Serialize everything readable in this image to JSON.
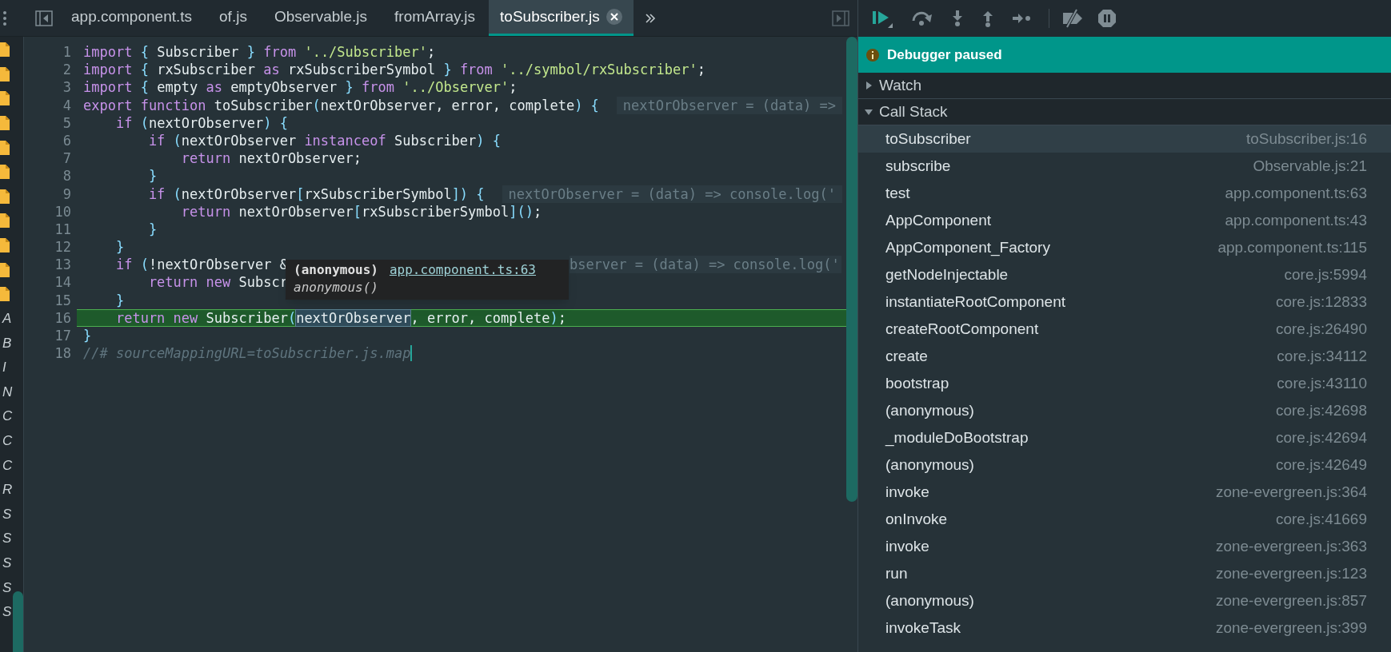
{
  "navigator": {
    "items": [
      {
        "kind": "file"
      },
      {
        "kind": "file"
      },
      {
        "kind": "file"
      },
      {
        "kind": "file"
      },
      {
        "kind": "file"
      },
      {
        "kind": "file"
      },
      {
        "kind": "file"
      },
      {
        "kind": "file"
      },
      {
        "kind": "file"
      },
      {
        "kind": "file"
      },
      {
        "kind": "file"
      },
      {
        "kind": "name",
        "text": "A"
      },
      {
        "kind": "name",
        "text": "B"
      },
      {
        "kind": "name",
        "text": "I"
      },
      {
        "kind": "name",
        "text": "N"
      },
      {
        "kind": "name",
        "text": "C"
      },
      {
        "kind": "name",
        "text": "C"
      },
      {
        "kind": "name",
        "text": "C"
      },
      {
        "kind": "name",
        "text": "R"
      },
      {
        "kind": "name",
        "text": "S"
      },
      {
        "kind": "name",
        "text": "S"
      },
      {
        "kind": "name",
        "text": "S"
      },
      {
        "kind": "name",
        "text": "S"
      },
      {
        "kind": "name",
        "text": "S"
      }
    ]
  },
  "tabs": [
    {
      "label": "app.component.ts",
      "selected": false
    },
    {
      "label": "of.js",
      "selected": false
    },
    {
      "label": "Observable.js",
      "selected": false
    },
    {
      "label": "fromArray.js",
      "selected": false
    },
    {
      "label": "toSubscriber.js",
      "selected": true
    }
  ],
  "editor": {
    "lines": [
      {
        "number": "1",
        "current": false,
        "tokens": [
          {
            "kind": "k",
            "text": "import "
          },
          {
            "kind": "p",
            "text": "{"
          },
          {
            "kind": "i",
            "text": " Subscriber "
          },
          {
            "kind": "p",
            "text": "} "
          },
          {
            "kind": "k",
            "text": "from "
          },
          {
            "kind": "s",
            "text": "'../Subscriber'"
          },
          {
            "kind": "i",
            "text": ";"
          }
        ]
      },
      {
        "number": "2",
        "current": false,
        "tokens": [
          {
            "kind": "k",
            "text": "import "
          },
          {
            "kind": "p",
            "text": "{"
          },
          {
            "kind": "i",
            "text": " rxSubscriber "
          },
          {
            "kind": "k",
            "text": "as"
          },
          {
            "kind": "i",
            "text": " rxSubscriberSymbol "
          },
          {
            "kind": "p",
            "text": "} "
          },
          {
            "kind": "k",
            "text": "from "
          },
          {
            "kind": "s",
            "text": "'../symbol/rxSubscriber'"
          },
          {
            "kind": "i",
            "text": ";"
          }
        ]
      },
      {
        "number": "3",
        "current": false,
        "tokens": [
          {
            "kind": "k",
            "text": "import "
          },
          {
            "kind": "p",
            "text": "{"
          },
          {
            "kind": "i",
            "text": " empty "
          },
          {
            "kind": "k",
            "text": "as"
          },
          {
            "kind": "i",
            "text": " emptyObserver "
          },
          {
            "kind": "p",
            "text": "} "
          },
          {
            "kind": "k",
            "text": "from "
          },
          {
            "kind": "s",
            "text": "'../Observer'"
          },
          {
            "kind": "i",
            "text": ";"
          }
        ]
      },
      {
        "number": "4",
        "current": false,
        "tokens": [
          {
            "kind": "k",
            "text": "export function"
          },
          {
            "kind": "i",
            "text": " toSubscriber"
          },
          {
            "kind": "p",
            "text": "("
          },
          {
            "kind": "i",
            "text": "nextOrObserver, error, complete"
          },
          {
            "kind": "p",
            "text": ") {"
          }
        ],
        "inline_value": {
          "text": "nextOrObserver = (data) =>",
          "cut_left": false
        }
      },
      {
        "number": "5",
        "current": false,
        "tokens": [
          {
            "kind": "k",
            "text": "    if"
          },
          {
            "kind": "p",
            "text": " ("
          },
          {
            "kind": "i",
            "text": "nextOrObserver"
          },
          {
            "kind": "p",
            "text": ") {"
          }
        ]
      },
      {
        "number": "6",
        "current": false,
        "tokens": [
          {
            "kind": "k",
            "text": "        if"
          },
          {
            "kind": "p",
            "text": " ("
          },
          {
            "kind": "i",
            "text": "nextOrObserver "
          },
          {
            "kind": "k",
            "text": "instanceof"
          },
          {
            "kind": "i",
            "text": " Subscriber"
          },
          {
            "kind": "p",
            "text": ") {"
          }
        ]
      },
      {
        "number": "7",
        "current": false,
        "tokens": [
          {
            "kind": "k",
            "text": "            return"
          },
          {
            "kind": "i",
            "text": " nextOrObserver;"
          }
        ]
      },
      {
        "number": "8",
        "current": false,
        "tokens": [
          {
            "kind": "p",
            "text": "        }"
          }
        ]
      },
      {
        "number": "9",
        "current": false,
        "tokens": [
          {
            "kind": "k",
            "text": "        if"
          },
          {
            "kind": "p",
            "text": " ("
          },
          {
            "kind": "i",
            "text": "nextOrObserver"
          },
          {
            "kind": "p",
            "text": "["
          },
          {
            "kind": "i",
            "text": "rxSubscriberSymbol"
          },
          {
            "kind": "p",
            "text": "]) {"
          }
        ],
        "inline_value": {
          "text": "nextOrObserver = (data) => console.log('",
          "cut_left": false
        }
      },
      {
        "number": "10",
        "current": false,
        "tokens": [
          {
            "kind": "k",
            "text": "            return"
          },
          {
            "kind": "i",
            "text": " nextOrObserver"
          },
          {
            "kind": "p",
            "text": "["
          },
          {
            "kind": "i",
            "text": "rxSubscriberSymbol"
          },
          {
            "kind": "p",
            "text": "]()"
          },
          {
            "kind": "i",
            "text": ";"
          }
        ]
      },
      {
        "number": "11",
        "current": false,
        "tokens": [
          {
            "kind": "p",
            "text": "        }"
          }
        ]
      },
      {
        "number": "12",
        "current": false,
        "tokens": [
          {
            "kind": "p",
            "text": "    }"
          }
        ]
      },
      {
        "number": "13",
        "current": false,
        "tokens": [
          {
            "kind": "k",
            "text": "    if"
          },
          {
            "kind": "p",
            "text": " ("
          },
          {
            "kind": "i",
            "text": "!nextOrObserver &"
          }
        ],
        "inline_value": {
          "text": "bserver = (data) => console.log('",
          "cut_left": true
        }
      },
      {
        "number": "14",
        "current": false,
        "tokens": [
          {
            "kind": "k",
            "text": "        return new"
          },
          {
            "kind": "i",
            "text": " Subscr"
          }
        ]
      },
      {
        "number": "15",
        "current": false,
        "tokens": [
          {
            "kind": "p",
            "text": "    }"
          }
        ]
      },
      {
        "number": "16",
        "current": true,
        "tokens": [
          {
            "kind": "k",
            "text": "    return new"
          },
          {
            "kind": "i",
            "text": " Subscriber"
          },
          {
            "kind": "p",
            "text": "("
          },
          {
            "kind": "h",
            "text": "nextOrObserver"
          },
          {
            "kind": "i",
            "text": ", error, complete"
          },
          {
            "kind": "p",
            "text": ")"
          },
          {
            "kind": "i",
            "text": ";"
          }
        ]
      },
      {
        "number": "17",
        "current": false,
        "tokens": [
          {
            "kind": "p",
            "text": "}"
          }
        ]
      },
      {
        "number": "18",
        "current": false,
        "cursor": true,
        "tokens": [
          {
            "kind": "c",
            "text": "//# sourceMappingURL=toSubscriber.js.map"
          }
        ]
      }
    ]
  },
  "tooltip": {
    "function": "(anonymous)",
    "location": "app.component.ts:63",
    "signature": "anonymous()"
  },
  "debugger": {
    "banner": "Debugger paused",
    "sections": [
      {
        "title": "Watch",
        "expanded": false
      },
      {
        "title": "Call Stack",
        "expanded": true
      }
    ],
    "frames": [
      {
        "function": "toSubscriber",
        "location": "toSubscriber.js:16",
        "selected": true
      },
      {
        "function": "subscribe",
        "location": "Observable.js:21",
        "selected": false
      },
      {
        "function": "test",
        "location": "app.component.ts:63",
        "selected": false
      },
      {
        "function": "AppComponent",
        "location": "app.component.ts:43",
        "selected": false
      },
      {
        "function": "AppComponent_Factory",
        "location": "app.component.ts:115",
        "selected": false
      },
      {
        "function": "getNodeInjectable",
        "location": "core.js:5994",
        "selected": false
      },
      {
        "function": "instantiateRootComponent",
        "location": "core.js:12833",
        "selected": false
      },
      {
        "function": "createRootComponent",
        "location": "core.js:26490",
        "selected": false
      },
      {
        "function": "create",
        "location": "core.js:34112",
        "selected": false
      },
      {
        "function": "bootstrap",
        "location": "core.js:43110",
        "selected": false
      },
      {
        "function": "(anonymous)",
        "location": "core.js:42698",
        "selected": false
      },
      {
        "function": "_moduleDoBootstrap",
        "location": "core.js:42694",
        "selected": false
      },
      {
        "function": "(anonymous)",
        "location": "core.js:42649",
        "selected": false
      },
      {
        "function": "invoke",
        "location": "zone-evergreen.js:364",
        "selected": false
      },
      {
        "function": "onInvoke",
        "location": "core.js:41669",
        "selected": false
      },
      {
        "function": "invoke",
        "location": "zone-evergreen.js:363",
        "selected": false
      },
      {
        "function": "run",
        "location": "zone-evergreen.js:123",
        "selected": false
      },
      {
        "function": "(anonymous)",
        "location": "zone-evergreen.js:857",
        "selected": false
      },
      {
        "function": "invokeTask",
        "location": "zone-evergreen.js:399",
        "selected": false
      }
    ]
  }
}
